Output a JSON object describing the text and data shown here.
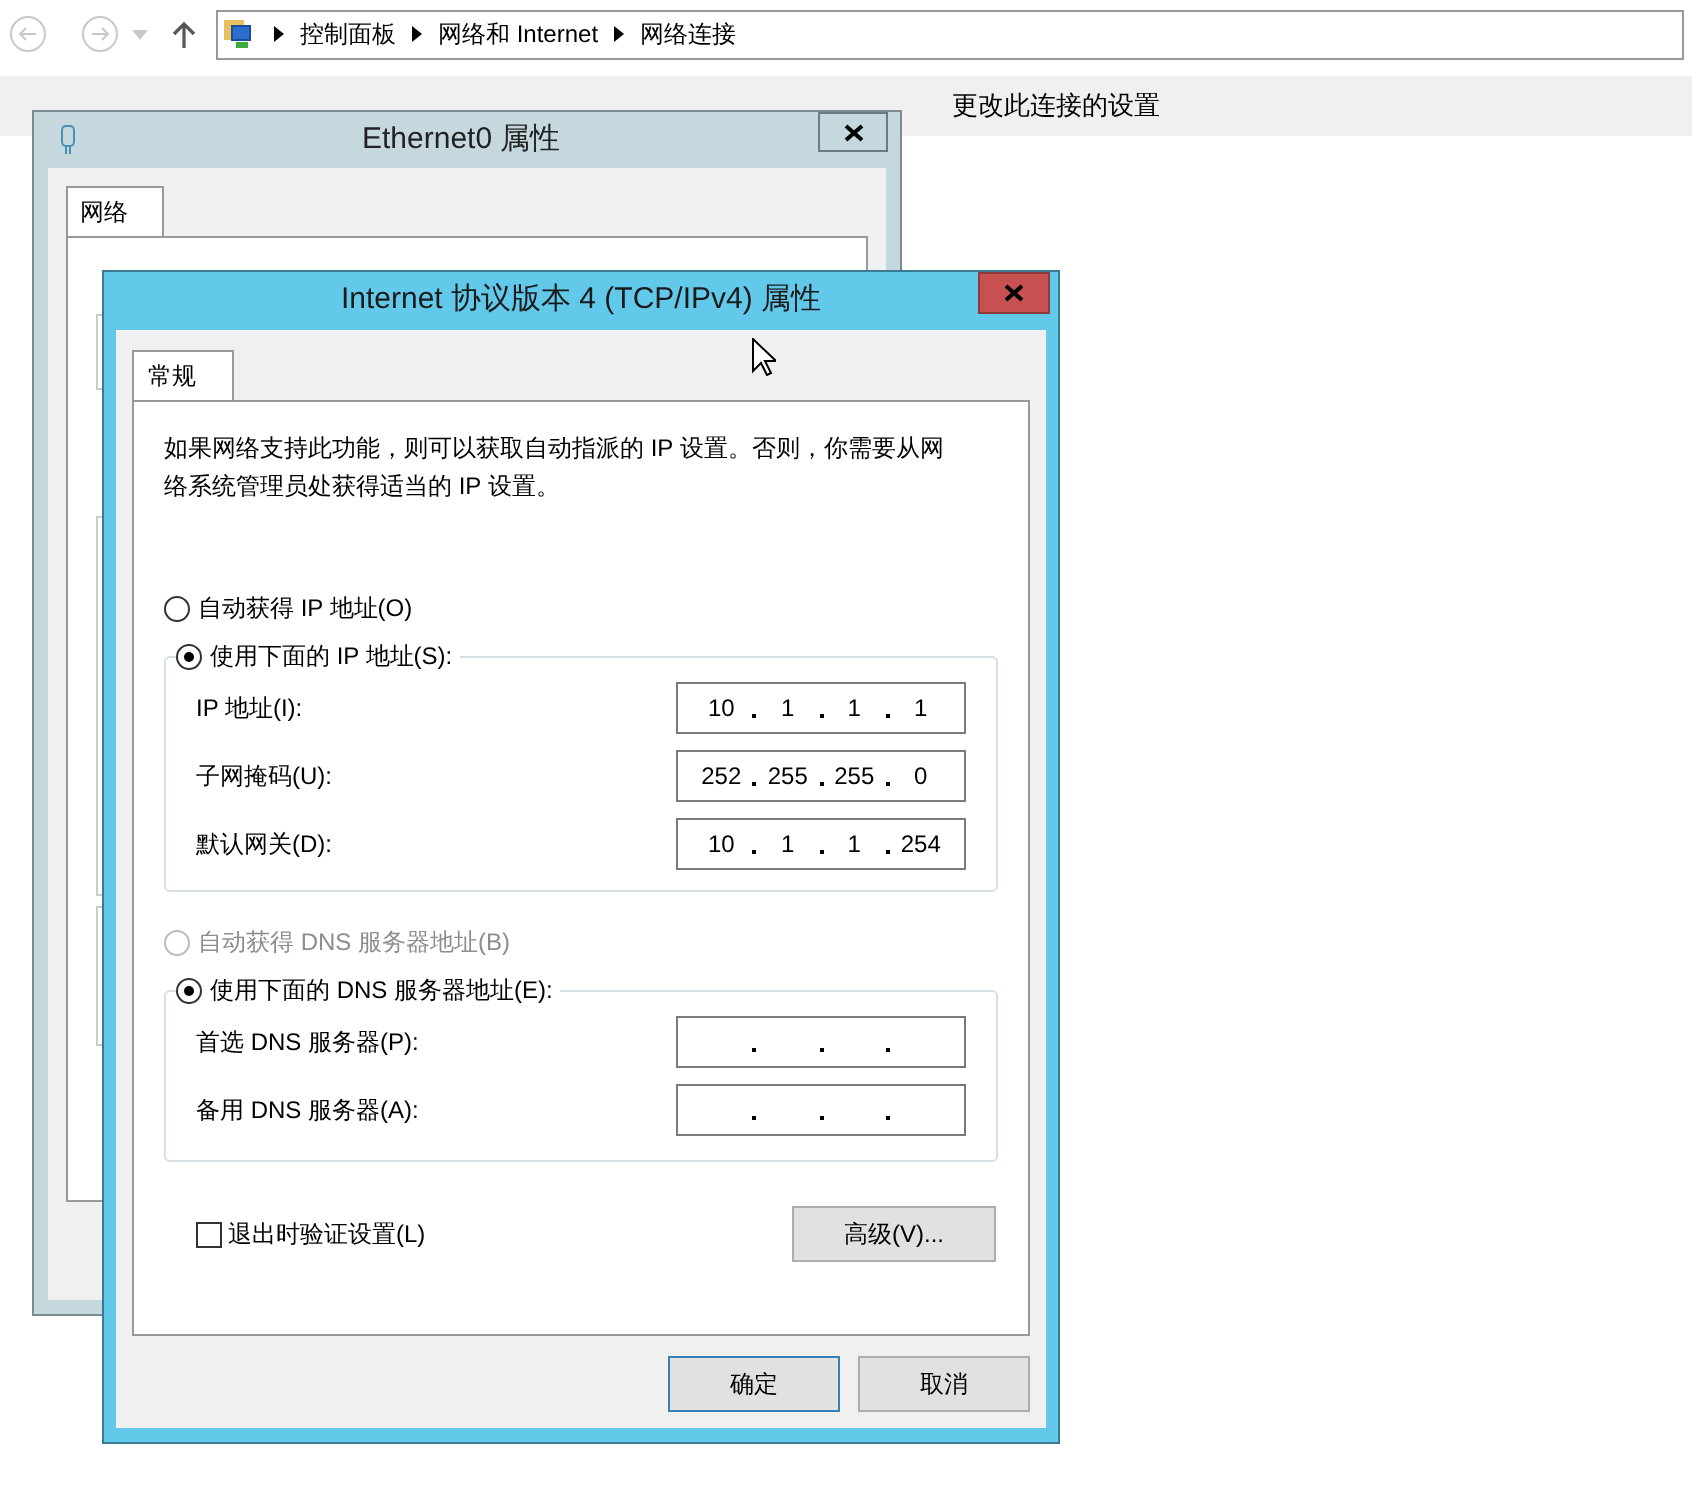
{
  "explorer": {
    "breadcrumbs": [
      "控制面板",
      "网络和 Internet",
      "网络连接"
    ],
    "toolbar": [
      "更改此连接的设置"
    ]
  },
  "ethernet_dialog": {
    "title": "Ethernet0 属性",
    "tabs": [
      {
        "label": "网络",
        "selected": true
      }
    ]
  },
  "ipv4_dialog": {
    "title": "Internet 协议版本 4 (TCP/IPv4) 属性",
    "tabs": [
      {
        "label": "常规",
        "selected": true
      }
    ],
    "description": "如果网络支持此功能，则可以获取自动指派的 IP 设置。否则，你需要从网络系统管理员处获得适当的 IP 设置。",
    "ip_mode": [
      {
        "label": "自动获得 IP 地址(O)",
        "selected": false,
        "disabled": false
      },
      {
        "label": "使用下面的 IP 地址(S):",
        "selected": true,
        "disabled": false
      }
    ],
    "ip_fields": [
      {
        "label": "IP 地址(I):",
        "octets": [
          "10",
          "1",
          "1",
          "1"
        ]
      },
      {
        "label": "子网掩码(U):",
        "octets": [
          "252",
          "255",
          "255",
          "0"
        ]
      },
      {
        "label": "默认网关(D):",
        "octets": [
          "10",
          "1",
          "1",
          "254"
        ]
      }
    ],
    "dns_mode": [
      {
        "label": "自动获得 DNS 服务器地址(B)",
        "selected": false,
        "disabled": true
      },
      {
        "label": "使用下面的 DNS 服务器地址(E):",
        "selected": true,
        "disabled": false
      }
    ],
    "dns_fields": [
      {
        "label": "首选 DNS 服务器(P):"
      },
      {
        "label": "备用 DNS 服务器(A):"
      }
    ],
    "verify_on_exit": {
      "label": "退出时验证设置(L)",
      "checked": false
    },
    "advanced_button": "高级(V)...",
    "buttons": [
      {
        "label": "确定",
        "default": true
      },
      {
        "label": "取消",
        "default": false
      }
    ]
  }
}
